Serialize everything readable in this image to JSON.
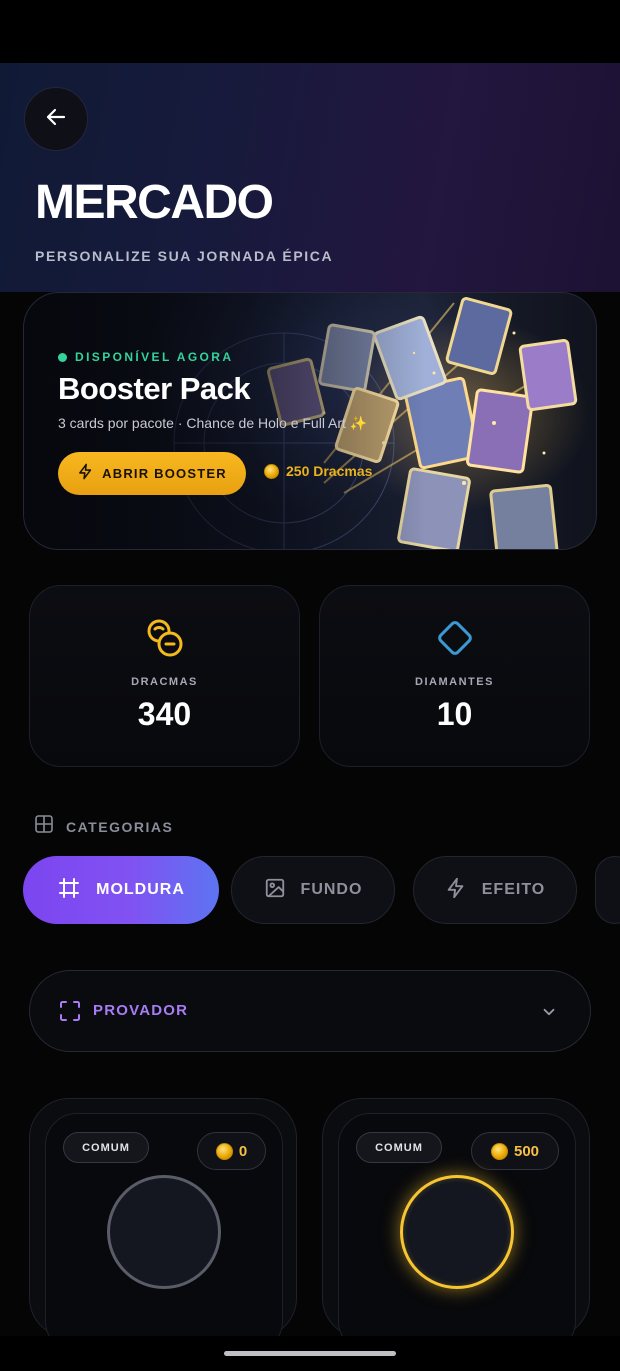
{
  "header": {
    "title": "MERCADO",
    "subtitle": "PERSONALIZE SUA JORNADA ÉPICA"
  },
  "booster": {
    "status": "DISPONÍVEL AGORA",
    "title": "Booster Pack",
    "description": "3 cards por pacote · Chance de Holo e Full Art ✨",
    "button_label": "ABRIR BOOSTER",
    "price_label": "250 Dracmas"
  },
  "stats": [
    {
      "label": "DRACMAS",
      "value": "340",
      "icon": "coins-icon",
      "color": "#f5b91c"
    },
    {
      "label": "DIAMANTES",
      "value": "10",
      "icon": "diamond-icon",
      "color": "#3b9ad3"
    }
  ],
  "categories": {
    "label": "CATEGORIAS",
    "tabs": [
      {
        "label": "MOLDURA",
        "icon": "frame-icon",
        "active": true
      },
      {
        "label": "FUNDO",
        "icon": "image-icon",
        "active": false
      },
      {
        "label": "EFEITO",
        "icon": "lightning-icon",
        "active": false
      }
    ]
  },
  "provador": {
    "label": "PROVADOR"
  },
  "items": [
    {
      "rarity": "COMUM",
      "price": "0",
      "frame_color": "#5a5d68"
    },
    {
      "rarity": "COMUM",
      "price": "500",
      "frame_color": "#f7c531"
    }
  ],
  "colors": {
    "accent_purple": "#8152f2",
    "accent_gold": "#f8b820",
    "available_green": "#34d399"
  }
}
